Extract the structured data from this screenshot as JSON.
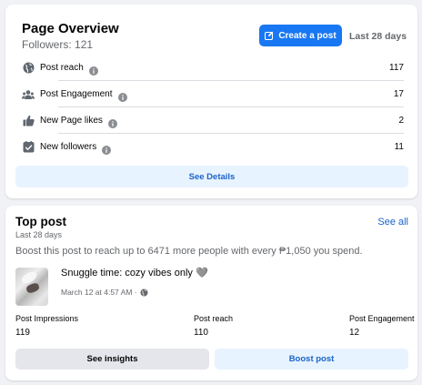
{
  "overview": {
    "title": "Page Overview",
    "followers": "Followers: 121",
    "create_post_label": "Create a post",
    "period": "Last 28 days",
    "metrics": [
      {
        "label": "Post reach",
        "value": "117",
        "icon": "globe-icon"
      },
      {
        "label": "Post Engagement",
        "value": "17",
        "icon": "people-icon"
      },
      {
        "label": "New Page likes",
        "value": "2",
        "icon": "thumbs-up-icon"
      },
      {
        "label": "New followers",
        "value": "11",
        "icon": "follow-check-icon"
      }
    ],
    "see_details_label": "See Details"
  },
  "top_post": {
    "title": "Top post",
    "see_all_label": "See all",
    "period": "Last 28 days",
    "boost_text": "Boost this post to reach up to 6471 more people with every ₱1,050 you spend.",
    "post": {
      "title": "Snuggle time: cozy vibes only 🩶",
      "date": "March 12 at 4:57 AM ·"
    },
    "stats": [
      {
        "label": "Post Impressions",
        "value": "119"
      },
      {
        "label": "Post reach",
        "value": "110"
      },
      {
        "label": "Post Engagement",
        "value": "12"
      }
    ],
    "see_insights_label": "See insights",
    "boost_post_label": "Boost post"
  },
  "colors": {
    "accent": "#1877f2",
    "link": "#1b63c9",
    "muted_text": "#65676b",
    "background": "#f0f2f5"
  }
}
